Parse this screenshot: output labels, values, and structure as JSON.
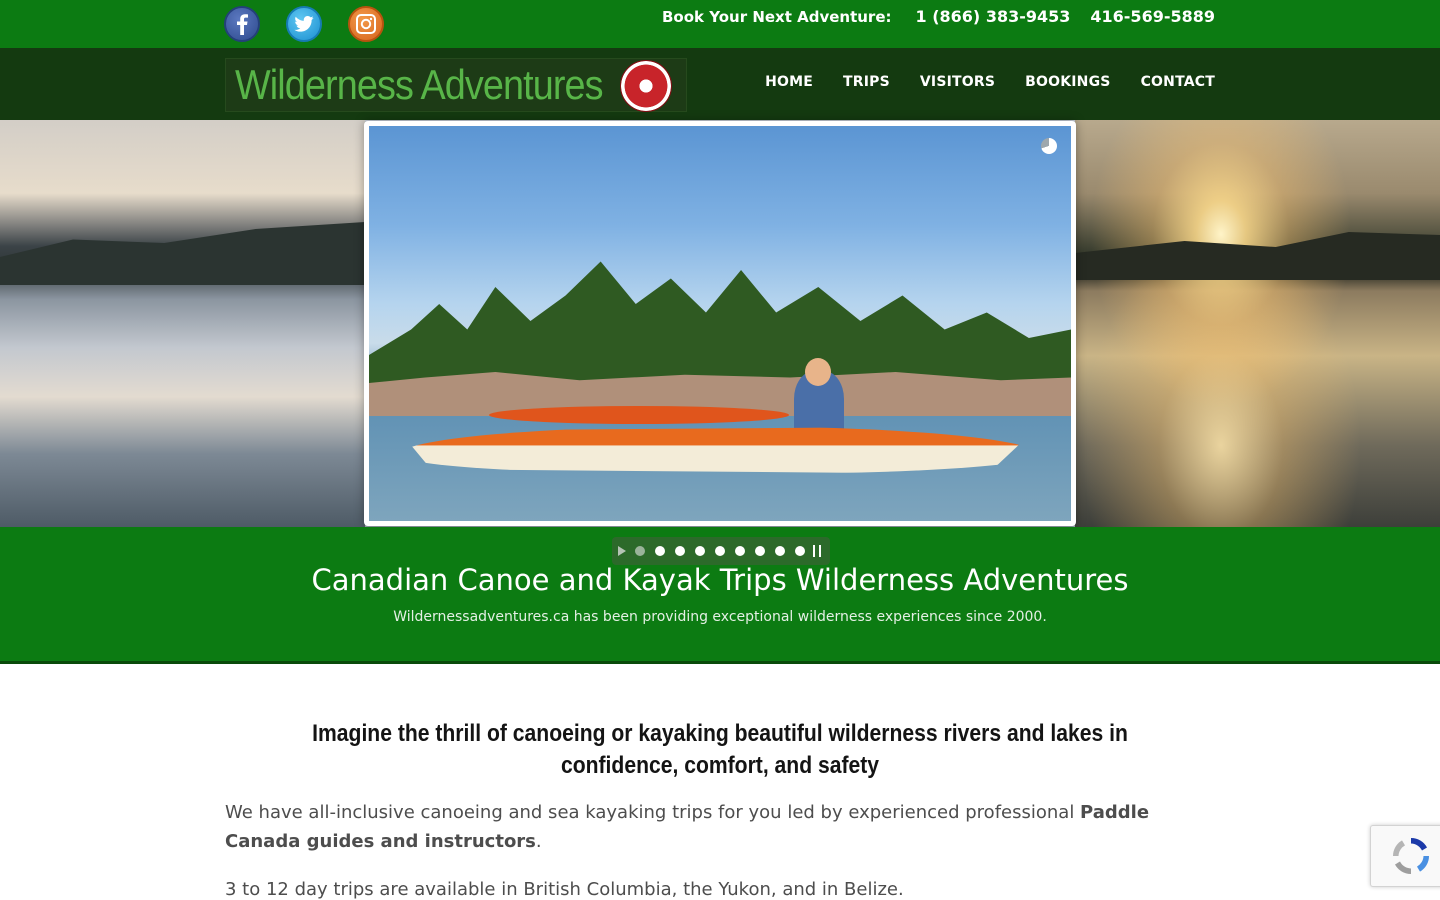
{
  "topbar": {
    "social": [
      "facebook-icon",
      "twitter-icon",
      "instagram-icon"
    ],
    "book_label": "Book Your Next Adventure:",
    "phone1": "1 (866) 383-9453",
    "phone2": "416-569-5889"
  },
  "header": {
    "logo_text": "Wilderness Adventures",
    "nav": [
      "HOME",
      "TRIPS",
      "VISITORS",
      "BOOKINGS",
      "CONTACT"
    ]
  },
  "slider": {
    "slide_count": 9,
    "active_index": 0
  },
  "banner": {
    "title": "Canadian Canoe and Kayak Trips Wilderness Adventures",
    "subtitle": "Wildernessadventures.ca has been providing exceptional wilderness experiences since 2000."
  },
  "content": {
    "heading": "Imagine the thrill of canoeing or kayaking beautiful wilderness rivers and lakes in confidence, comfort, and safety",
    "p1_text": "We have all-inclusive canoeing and sea kayaking trips for you led by experienced professional ",
    "p1_bold": "Paddle Canada guides and instructors",
    "p1_end": ".",
    "p2": "3 to 12 day trips are available in British Columbia, the Yukon, and in Belize."
  },
  "colors": {
    "topbar_green": "#0c7b12",
    "header_dark": "#143a10",
    "logo_green": "#58b548"
  }
}
